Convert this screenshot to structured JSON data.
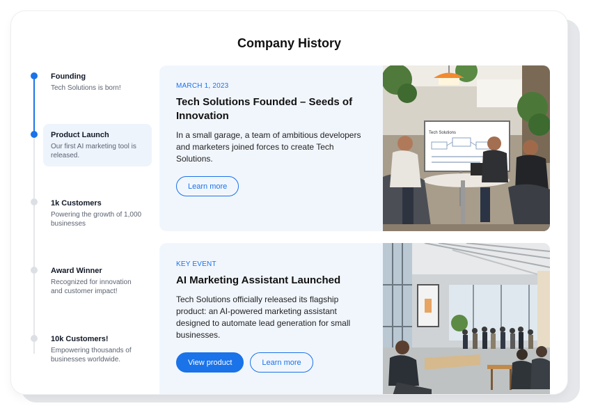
{
  "page": {
    "title": "Company History"
  },
  "timeline": [
    {
      "title": "Founding",
      "desc": "Tech Solutions is born!",
      "active": true,
      "selected": false
    },
    {
      "title": "Product Launch",
      "desc": "Our first AI marketing tool is released.",
      "active": true,
      "selected": true
    },
    {
      "title": "1k Customers",
      "desc": "Powering the growth of 1,000 businesses",
      "active": false,
      "selected": false
    },
    {
      "title": "Award Winner",
      "desc": "Recognized for innovation and customer impact!",
      "active": false,
      "selected": false
    },
    {
      "title": "10k Customers!",
      "desc": "Empowering thousands of businesses worldwide.",
      "active": false,
      "selected": false
    }
  ],
  "events": [
    {
      "eyebrow": "MARCH 1, 2023",
      "title": "Tech Solutions Founded – Seeds of Innovation",
      "body": "In a small garage, a team of ambitious developers and marketers joined forces to create Tech Solutions.",
      "buttons": [
        {
          "label": "Learn more",
          "style": "outline"
        }
      ],
      "image": {
        "icon": "team-meeting-photo",
        "whiteboard_text": "Tech Solutions"
      }
    },
    {
      "eyebrow": "KEY EVENT",
      "title": "AI Marketing Assistant Launched",
      "body": "Tech Solutions officially released its flagship product: an AI-powered marketing assistant designed to automate lead generation for small businesses.",
      "buttons": [
        {
          "label": "View product",
          "style": "primary"
        },
        {
          "label": "Learn more",
          "style": "outline"
        }
      ],
      "image": {
        "icon": "conference-event-photo"
      }
    }
  ],
  "colors": {
    "accent": "#1a73e8",
    "panel_bg": "#f1f6fd",
    "selected_bg": "#eef4fc",
    "line_inactive": "#e4e6ea"
  }
}
